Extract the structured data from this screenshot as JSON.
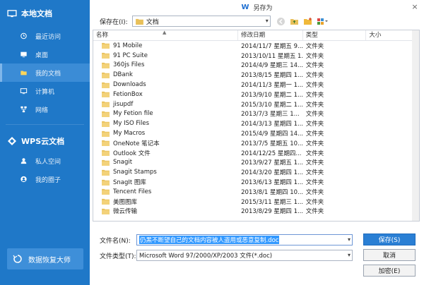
{
  "sidebar": {
    "header": "本地文档",
    "items": [
      {
        "label": "最近访问"
      },
      {
        "label": "桌面"
      },
      {
        "label": "我的文档"
      },
      {
        "label": "计算机"
      },
      {
        "label": "网络"
      }
    ],
    "cloud_header": "WPS云文档",
    "cloud_items": [
      {
        "label": "私人空间"
      },
      {
        "label": "我的圈子"
      }
    ],
    "recover_button": "数据恢复大师"
  },
  "dialog": {
    "title": "另存为",
    "close": "×",
    "location_label": "保存在(I):",
    "location_value": "文档",
    "columns": {
      "name": "名称",
      "date": "修改日期",
      "type": "类型",
      "size": "大小"
    },
    "files": [
      {
        "name": "91 Mobile",
        "date": "2014/11/7 星期五 9...",
        "type": "文件夹"
      },
      {
        "name": "91 PC Suite",
        "date": "2013/10/11 星期五 1...",
        "type": "文件夹"
      },
      {
        "name": "360js Files",
        "date": "2014/4/9 星期三 14...",
        "type": "文件夹"
      },
      {
        "name": "DBank",
        "date": "2013/8/15 星期四 1...",
        "type": "文件夹"
      },
      {
        "name": "Downloads",
        "date": "2014/11/3 星期一 1...",
        "type": "文件夹"
      },
      {
        "name": "FetionBox",
        "date": "2013/9/10 星期二 1...",
        "type": "文件夹"
      },
      {
        "name": "jisupdf",
        "date": "2015/3/10 星期二 1...",
        "type": "文件夹"
      },
      {
        "name": "My Fetion file",
        "date": "2013/7/3 星期三 1...",
        "type": "文件夹"
      },
      {
        "name": "My ISO Files",
        "date": "2014/3/13 星期四 1...",
        "type": "文件夹"
      },
      {
        "name": "My Macros",
        "date": "2015/4/9 星期四 14...",
        "type": "文件夹"
      },
      {
        "name": "OneNote 笔记本",
        "date": "2013/7/5 星期五 10...",
        "type": "文件夹"
      },
      {
        "name": "Outlook 文件",
        "date": "2014/12/25 星期四...",
        "type": "文件夹"
      },
      {
        "name": "Snagit",
        "date": "2013/9/27 星期五 1...",
        "type": "文件夹"
      },
      {
        "name": "Snagit Stamps",
        "date": "2014/3/20 星期四 1...",
        "type": "文件夹"
      },
      {
        "name": "SnagIt 图库",
        "date": "2013/6/13 星期四 1...",
        "type": "文件夹"
      },
      {
        "name": "Tencent Files",
        "date": "2013/8/1 星期四 10...",
        "type": "文件夹"
      },
      {
        "name": "美图图库",
        "date": "2015/3/11 星期三 1...",
        "type": "文件夹"
      },
      {
        "name": "微云传输",
        "date": "2013/8/29 星期四 1...",
        "type": "文件夹"
      }
    ],
    "filename_label": "文件名(N):",
    "filename_value": "仍黑不断望自己的文档内容被人盗用或恶意复制.doc",
    "filetype_label": "文件类型(T):",
    "filetype_value": "Microsoft Word 97/2000/XP/2003 文件(*.doc)",
    "save_button": "保存(S)",
    "cancel_button": "取消",
    "encrypt_button": "加密(E)"
  }
}
